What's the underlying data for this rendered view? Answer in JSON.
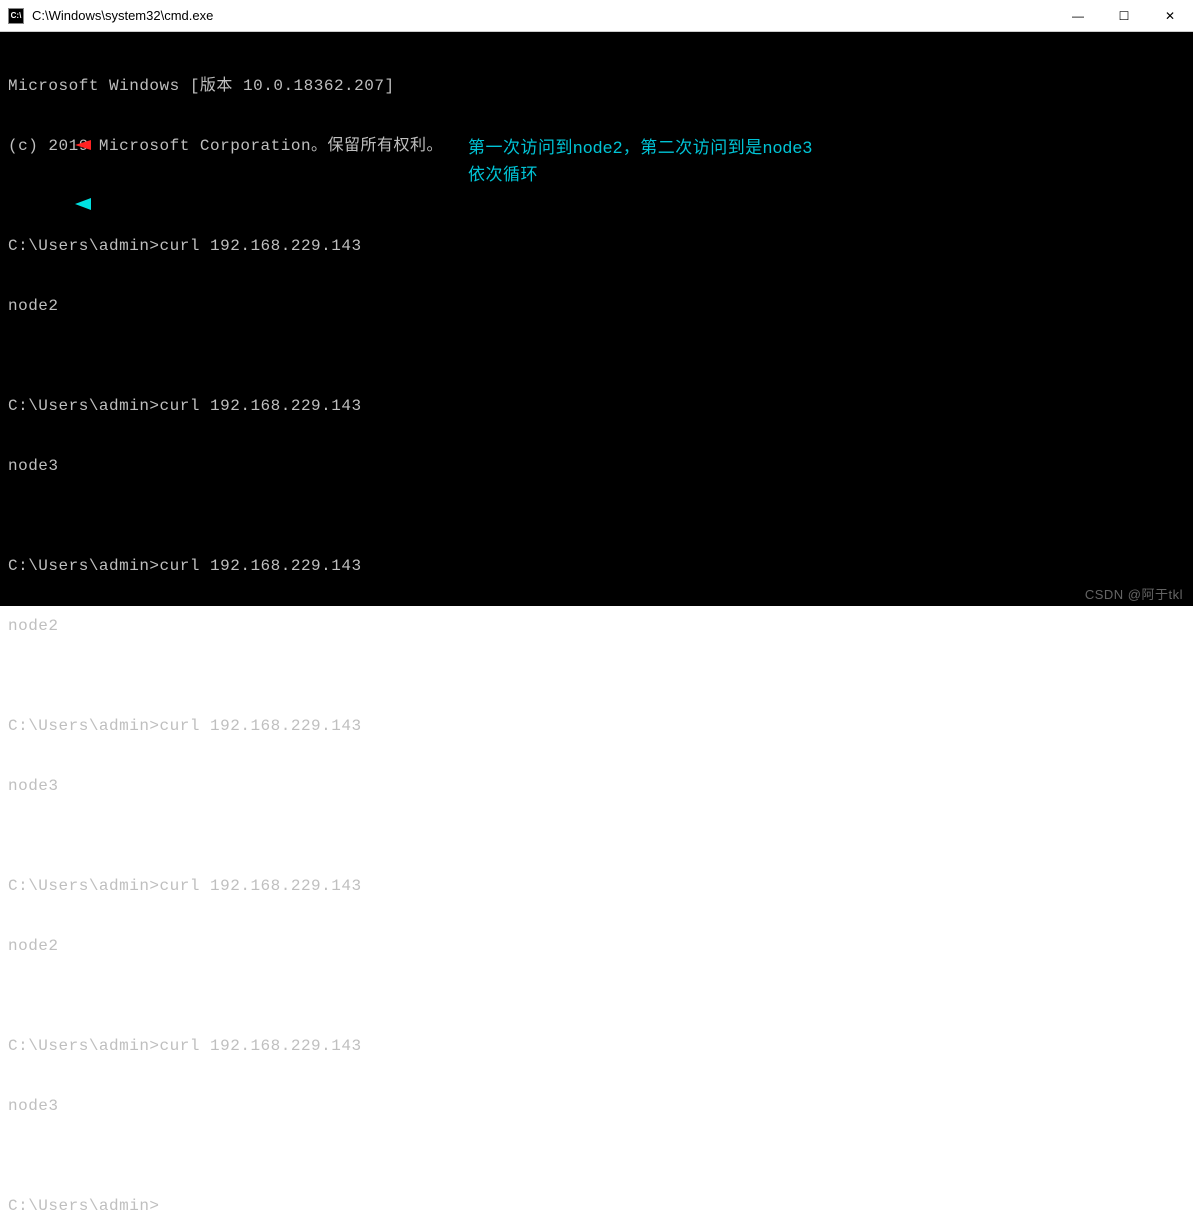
{
  "window": {
    "icon_label": "C:\\",
    "title": "C:\\Windows\\system32\\cmd.exe"
  },
  "controls": {
    "minimize": "—",
    "maximize": "☐",
    "close": "✕"
  },
  "terminal": {
    "header1": "Microsoft Windows [版本 10.0.18362.207]",
    "header2": "(c) 2019 Microsoft Corporation。保留所有权利。",
    "blank": "",
    "prompt_cmd": "C:\\Users\\admin>curl 192.168.229.143",
    "result_node2": "node2",
    "result_node3": "node3",
    "prompt_empty": "C:\\Users\\admin>"
  },
  "annotation": {
    "line1": "第一次访问到node2，第二次访问到是node3",
    "line2": "依次循环"
  },
  "watermark": "CSDN @阿于tkl"
}
